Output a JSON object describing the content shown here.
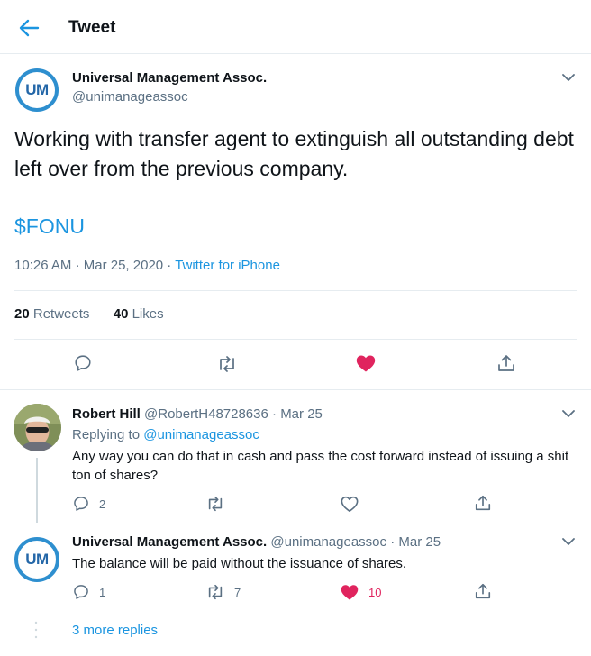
{
  "header": {
    "title": "Tweet"
  },
  "tweet": {
    "avatar_text": "UM",
    "name": "Universal Management Assoc.",
    "handle": "@unimanageassoc",
    "text": "Working with transfer agent to extinguish all outstanding debt left over from the previous company.",
    "cashtag": "$FONU",
    "time": "10:26 AM",
    "date": "Mar 25, 2020",
    "source": "Twitter for iPhone",
    "retweets_count": "20",
    "retweets_label": "Retweets",
    "likes_count": "40",
    "likes_label": "Likes"
  },
  "replies": [
    {
      "name": "Robert Hill",
      "handle": "@RobertH48728636",
      "date": "Mar 25",
      "replying_prefix": "Replying to",
      "replying_to": "@unimanageassoc",
      "text": "Any way you can do that in cash and pass the cost forward instead of issuing a shit ton of shares?",
      "reply_count": "2",
      "retweet_count": "",
      "like_count": ""
    },
    {
      "avatar_text": "UM",
      "name": "Universal Management Assoc.",
      "handle": "@unimanageassoc",
      "date": "Mar 25",
      "text": "The balance will be paid without the issuance of shares.",
      "reply_count": "1",
      "retweet_count": "7",
      "like_count": "10"
    }
  ],
  "more_replies": "3 more replies",
  "separator": "·",
  "colors": {
    "accent": "#1b95e0",
    "like": "#e0245e",
    "muted": "#5b7083",
    "avatar_ring": "#2e8fcf"
  },
  "icons": [
    "back-arrow-icon",
    "chevron-down-icon",
    "reply-icon",
    "retweet-icon",
    "like-icon-filled",
    "like-icon",
    "share-icon"
  ]
}
